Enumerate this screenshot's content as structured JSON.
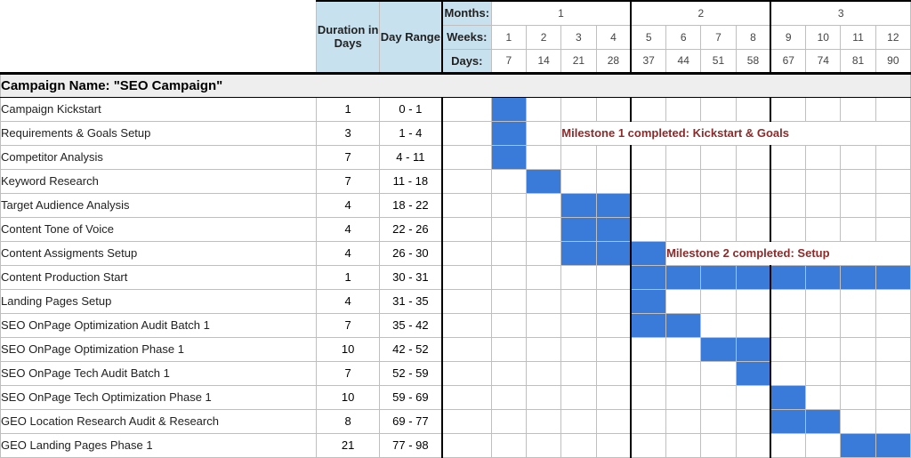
{
  "chart_data": {
    "type": "gantt",
    "title": "SEO Campaign",
    "header": {
      "duration_label": "Duration in Days",
      "range_label": "Day Range",
      "months_label": "Months:",
      "weeks_label": "Weeks:",
      "days_label": "Days:",
      "months": [
        1,
        2,
        3
      ],
      "weeks": [
        1,
        2,
        3,
        4,
        5,
        6,
        7,
        8,
        9,
        10,
        11,
        12
      ],
      "days": [
        7,
        14,
        21,
        28,
        37,
        44,
        51,
        58,
        67,
        74,
        81,
        90
      ]
    },
    "campaign_name_label": "Campaign Name: \"SEO Campaign\"",
    "tasks": [
      {
        "name": "Campaign Kickstart",
        "duration": 1,
        "range": "0 - 1",
        "cols": [
          0
        ]
      },
      {
        "name": "Requirements & Goals Setup",
        "duration": 3,
        "range": "1 - 4",
        "cols": [
          0
        ],
        "milestone": "Milestone 1 completed: Kickstart & Goals",
        "milestone_from": 2
      },
      {
        "name": "Competitor Analysis",
        "duration": 7,
        "range": "4 - 11",
        "cols": [
          0
        ]
      },
      {
        "name": "Keyword Research",
        "duration": 7,
        "range": "11 - 18",
        "cols": [
          1
        ]
      },
      {
        "name": "Target Audience Analysis",
        "duration": 4,
        "range": "18 - 22",
        "cols": [
          2,
          3
        ]
      },
      {
        "name": "Content Tone of Voice",
        "duration": 4,
        "range": "22 - 26",
        "cols": [
          2,
          3
        ]
      },
      {
        "name": "Content Assigments Setup",
        "duration": 4,
        "range": "26 - 30",
        "cols": [
          2,
          3,
          4
        ],
        "milestone": "Milestone 2 completed: Setup",
        "milestone_from": 5
      },
      {
        "name": "Content Production Start",
        "duration": 1,
        "range": "30 - 31",
        "cols": [
          4,
          5,
          6,
          7,
          8,
          9,
          10,
          11
        ]
      },
      {
        "name": "Landing Pages Setup",
        "duration": 4,
        "range": "31 - 35",
        "cols": [
          4
        ]
      },
      {
        "name": "SEO OnPage Optimization Audit Batch 1",
        "duration": 7,
        "range": "35 - 42",
        "cols": [
          4,
          5
        ]
      },
      {
        "name": "SEO OnPage Optimization Phase 1",
        "duration": 10,
        "range": "42 - 52",
        "cols": [
          6,
          7
        ]
      },
      {
        "name": "SEO OnPage Tech Audit Batch 1",
        "duration": 7,
        "range": "52 - 59",
        "cols": [
          7
        ]
      },
      {
        "name": "SEO OnPage Tech Optimization Phase 1",
        "duration": 10,
        "range": "59 - 69",
        "cols": [
          8
        ]
      },
      {
        "name": "GEO Location Research Audit & Research",
        "duration": 8,
        "range": "69 - 77",
        "cols": [
          8,
          9
        ]
      },
      {
        "name": "GEO Landing Pages Phase 1",
        "duration": 21,
        "range": "77 - 98",
        "cols": [
          10,
          11
        ]
      }
    ]
  }
}
